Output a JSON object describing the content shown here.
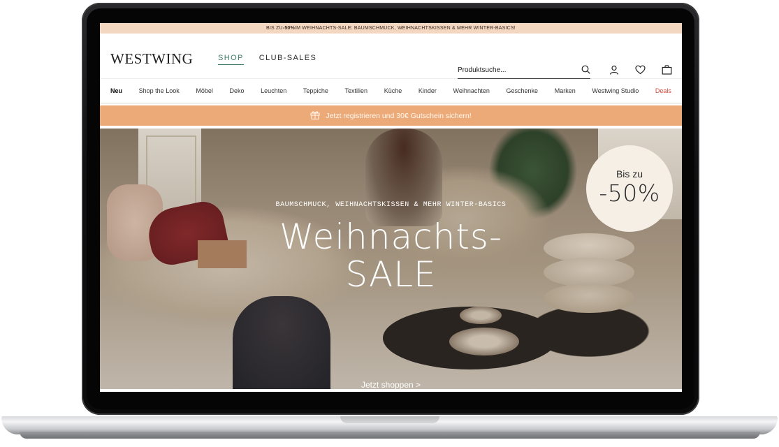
{
  "promo_bar": {
    "prefix": "BIS ZU ",
    "highlight": "-50%",
    "suffix": " IM WEIHNACHTS-SALE: BAUMSCHMUCK, WEIHNACHTSKISSEN & MEHR WINTER-BASICS!"
  },
  "header": {
    "logo": "WESTWING",
    "nav": [
      "SHOP",
      "CLUB-SALES"
    ],
    "search_placeholder": "Produktsuche...",
    "icons": [
      "search-icon",
      "user-icon",
      "heart-icon",
      "bag-icon"
    ]
  },
  "category_nav": [
    "Neu",
    "Shop the Look",
    "Möbel",
    "Deko",
    "Leuchten",
    "Teppiche",
    "Textilien",
    "Küche",
    "Kinder",
    "Weihnachten",
    "Geschenke",
    "Marken",
    "Westwing Studio",
    "Deals"
  ],
  "register_bar": {
    "text": "Jetzt registrieren und 30€ Gutschein sichern!",
    "icon": "gift-icon"
  },
  "hero": {
    "subtitle": "BAUMSCHMUCK, WEIHNACHTSKISSEN & MEHR WINTER-BASICS",
    "title_line1": "Weihnachts-",
    "title_line2": "SALE",
    "cta": "Jetzt shoppen >",
    "badge_line1": "Bis zu",
    "badge_line2": "-50%"
  },
  "colors": {
    "promo_bg": "#f3d7c0",
    "accent_green": "#3e7d66",
    "register_bg": "#ecaa78",
    "deals_red": "#d3473a",
    "badge_bg": "#f5efe6"
  }
}
